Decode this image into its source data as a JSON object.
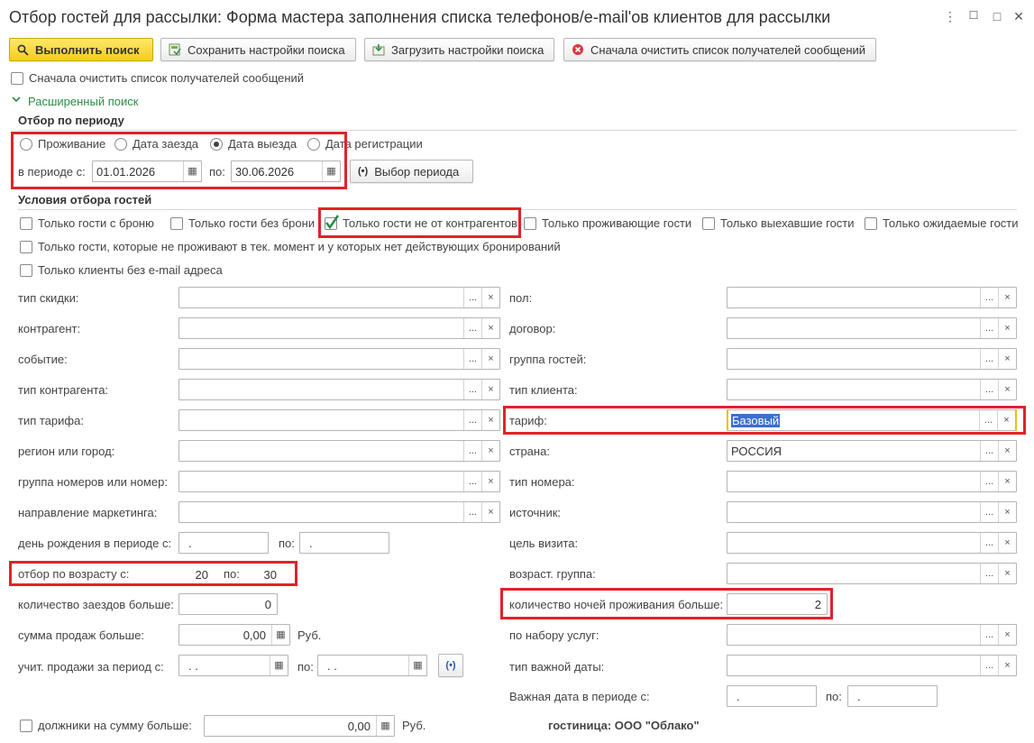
{
  "window": {
    "title": "Отбор гостей для рассылки: Форма мастера заполнения списка телефонов/e-mail'ов клиентов для рассылки",
    "controls": {
      "more": "⋮",
      "minimize": "☐",
      "maximize": "□",
      "close": "✕"
    }
  },
  "toolbar": {
    "run_label": "Выполнить поиск",
    "save_label": "Сохранить настройки поиска",
    "load_label": "Загрузить настройки поиска",
    "clear_label": "Сначала очистить список получателей сообщений"
  },
  "clear_first_checkbox": {
    "label": "Сначала очистить список получателей сообщений",
    "checked": false
  },
  "advanced": {
    "label": "Расширенный поиск"
  },
  "period": {
    "section_title": "Отбор по периоду",
    "radios": [
      {
        "label": "Проживание",
        "selected": false
      },
      {
        "label": "Дата заезда",
        "selected": false
      },
      {
        "label": "Дата выезда",
        "selected": true
      },
      {
        "label": "Дата регистрации",
        "selected": false
      }
    ],
    "from_label": "в периоде с:",
    "from_value": "01.01.2026",
    "to_label": "по:",
    "to_value": "30.06.2026",
    "choose_label": "Выбор периода"
  },
  "conditions": {
    "section_title": "Условия отбора гостей",
    "checks": [
      {
        "label": "Только гости с броню",
        "checked": false
      },
      {
        "label": "Только гости без брони",
        "checked": false
      },
      {
        "label": "Только гости не от контрагентов",
        "checked": true
      },
      {
        "label": "Только проживающие гости",
        "checked": false
      },
      {
        "label": "Только выехавшие гости",
        "checked": false
      },
      {
        "label": "Только ожидаемые гости",
        "checked": false
      }
    ],
    "check_long": {
      "label": "Только гости, которые не проживают в тек. момент и у которых нет действующих бронирований",
      "checked": false
    },
    "check_email": {
      "label": "Только клиенты без e-mail адреса",
      "checked": false
    }
  },
  "left_fields": [
    {
      "label": "тип скидки:",
      "value": ""
    },
    {
      "label": "контрагент:",
      "value": ""
    },
    {
      "label": "событие:",
      "value": ""
    },
    {
      "label": "тип контрагента:",
      "value": ""
    },
    {
      "label": "тип тарифа:",
      "value": ""
    },
    {
      "label": "регион или город:",
      "value": ""
    },
    {
      "label": "группа номеров или номер:",
      "value": ""
    },
    {
      "label": "направление маркетинга:",
      "value": ""
    }
  ],
  "right_fields": [
    {
      "label": "пол:",
      "value": ""
    },
    {
      "label": "договор:",
      "value": ""
    },
    {
      "label": "группа гостей:",
      "value": ""
    },
    {
      "label": "тип клиента:",
      "value": ""
    },
    {
      "label": "тариф:",
      "value": "Базовый"
    },
    {
      "label": "страна:",
      "value": "РОССИЯ"
    },
    {
      "label": "тип номера:",
      "value": ""
    },
    {
      "label": "источник:",
      "value": ""
    },
    {
      "label": "цель визита:",
      "value": ""
    },
    {
      "label": "возраст. группа:",
      "value": ""
    }
  ],
  "birthday": {
    "label": "день рождения в периоде с:",
    "from": " .",
    "to_label": "по:",
    "to": " ."
  },
  "age": {
    "label": "отбор по возрасту с:",
    "from": "20",
    "to_label": "по:",
    "to": "30"
  },
  "checkins": {
    "label": "количество заездов больше:",
    "value": "0"
  },
  "nights": {
    "label": "количество ночей проживания больше:",
    "value": "2"
  },
  "sales": {
    "label": "сумма продаж больше:",
    "value": "0,00",
    "currency": "Руб."
  },
  "services": {
    "label": "по набору услуг:",
    "value": ""
  },
  "sales_period": {
    "label": "учит. продажи за период с:",
    "from": " .  .",
    "to_label": "по:",
    "to": " .  ."
  },
  "important_type": {
    "label": "тип важной даты:",
    "value": ""
  },
  "important_period": {
    "label": "Важная дата в периоде с:",
    "from": " .",
    "to_label": "по:",
    "to": " ."
  },
  "debtors": {
    "label": "должники на сумму больше:",
    "value": "0,00",
    "currency": "Руб.",
    "checked": false
  },
  "hotel": {
    "text": "гостиница: ООО \"Облако\""
  },
  "glyphs": {
    "dots": "...",
    "clear": "×",
    "calendar": "▦"
  },
  "colors": {
    "accent_yellow": "#f4cd1f",
    "highlight_red": "#e1222a",
    "green_check": "#2e8b45",
    "selection_blue": "#3b6fd0"
  }
}
